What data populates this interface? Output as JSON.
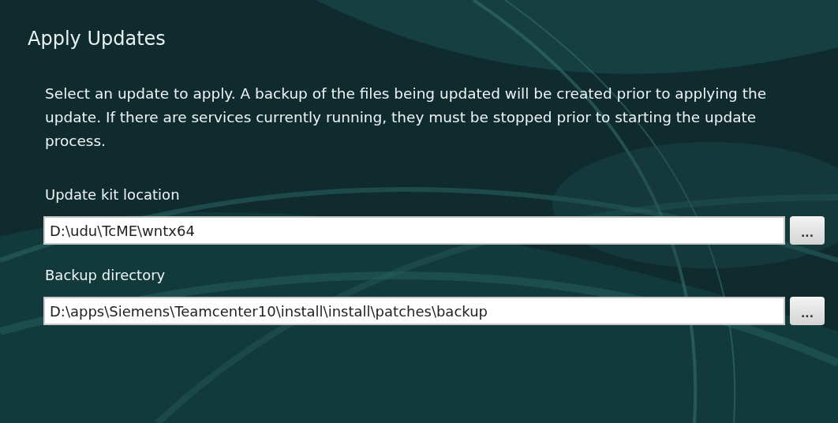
{
  "title": "Apply Updates",
  "description": "Select an update to apply.  A backup of the files being updated will be created prior to applying the update.  If there are services currently running, they must be stopped prior to starting the update process.",
  "fields": [
    {
      "label": "Update kit location",
      "value": "D:\\udu\\TcME\\wntx64",
      "button": "..."
    },
    {
      "label": "Backup directory",
      "value": "D:\\apps\\Siemens\\Teamcenter10\\install\\install\\patches\\backup",
      "button": "..."
    }
  ]
}
